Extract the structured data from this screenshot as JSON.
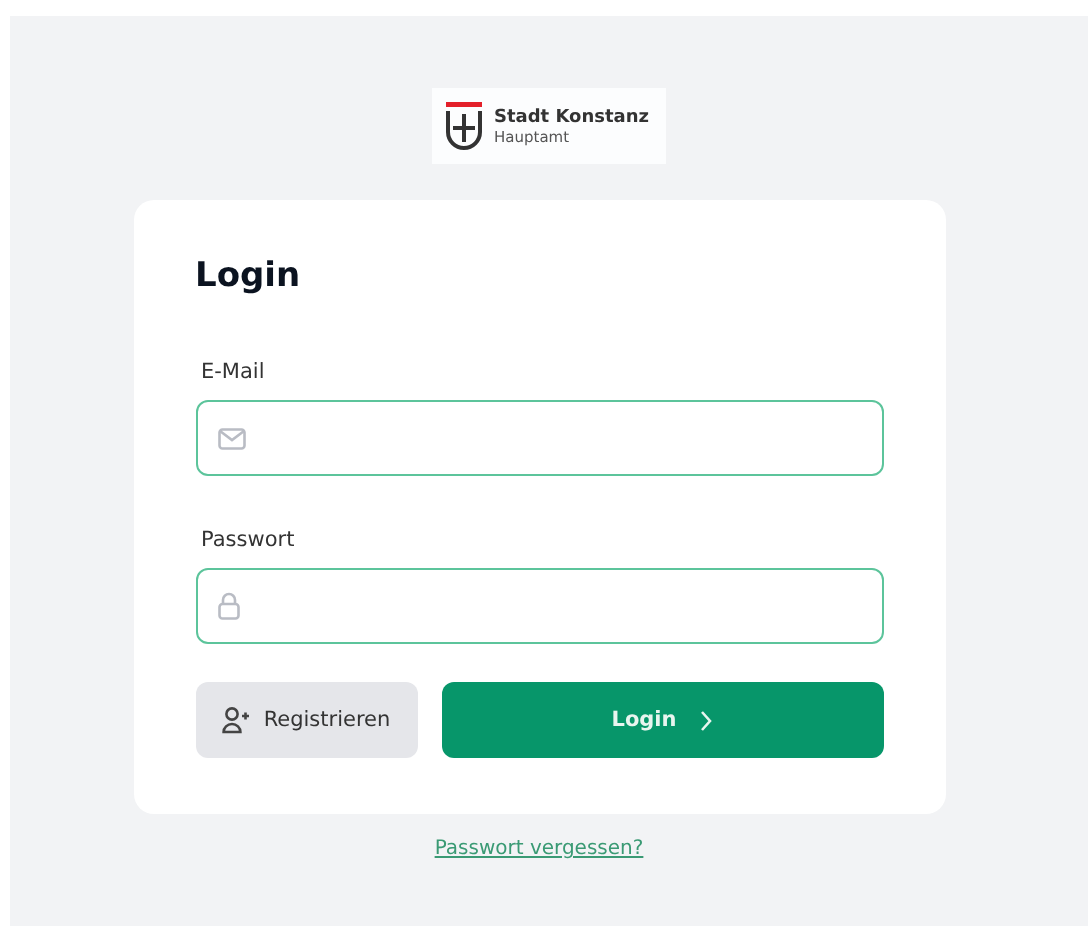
{
  "logo": {
    "title": "Stadt Konstanz",
    "subtitle": "Hauptamt"
  },
  "card": {
    "title": "Login",
    "fields": [
      {
        "kind": "email",
        "label": "E-Mail"
      },
      {
        "kind": "password",
        "label": "Passwort"
      }
    ],
    "buttons": [
      {
        "kind": "secondary",
        "label": "Registrieren"
      },
      {
        "kind": "primary",
        "label": "Login"
      }
    ]
  },
  "link": "Passwort vergessen?"
}
